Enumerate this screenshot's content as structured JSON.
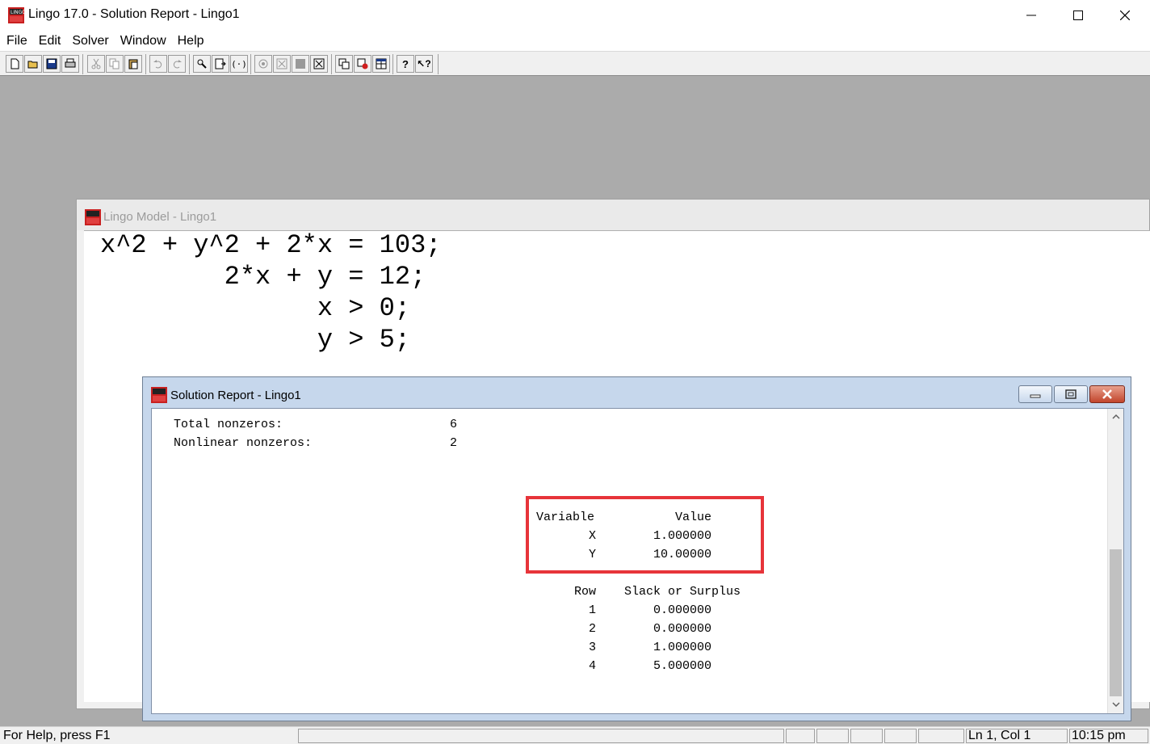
{
  "app": {
    "title": "Lingo 17.0 - Solution Report - Lingo1",
    "menu": [
      "File",
      "Edit",
      "Solver",
      "Window",
      "Help"
    ]
  },
  "toolbar": {
    "buttons": [
      "new-icon",
      "open-icon",
      "save-icon",
      "print-icon",
      "cut-icon",
      "copy-icon",
      "paste-icon",
      "undo-icon",
      "redo-icon",
      "find-icon",
      "goto-line-icon",
      "match-paren-icon",
      "solve-icon",
      "solver-status-icon",
      "stop-icon",
      "close-all-icon",
      "send-to-back-icon",
      "close-window-icon",
      "tile-icon",
      "help-icon",
      "context-help-icon"
    ]
  },
  "model_window": {
    "title": "Lingo Model - Lingo1",
    "code_lines": [
      "x^2 + y^2 + 2*x = 103;",
      "        2*x + y = 12;",
      "              x > 0;",
      "              y > 5;"
    ]
  },
  "report_window": {
    "title": "Solution Report - Lingo1",
    "stats": [
      {
        "label": "Total nonzeros:",
        "value": "6"
      },
      {
        "label": "Nonlinear nonzeros:",
        "value": "2"
      }
    ],
    "variables_header": {
      "name": "Variable",
      "value": "Value"
    },
    "variables": [
      {
        "name": "X",
        "value": "1.000000"
      },
      {
        "name": "Y",
        "value": "10.00000"
      }
    ],
    "rows_header": {
      "row": "Row",
      "value": "Slack or Surplus"
    },
    "rows": [
      {
        "row": "1",
        "value": "0.000000"
      },
      {
        "row": "2",
        "value": "0.000000"
      },
      {
        "row": "3",
        "value": "1.000000"
      },
      {
        "row": "4",
        "value": "5.000000"
      }
    ]
  },
  "status_bar": {
    "help_text": "For Help, press F1",
    "cursor": "Ln 1, Col 1",
    "time": "10:15 pm"
  },
  "colors": {
    "highlight": "#e7343a",
    "workspace": "#ababab",
    "report_frame": "#c6d7ec"
  }
}
